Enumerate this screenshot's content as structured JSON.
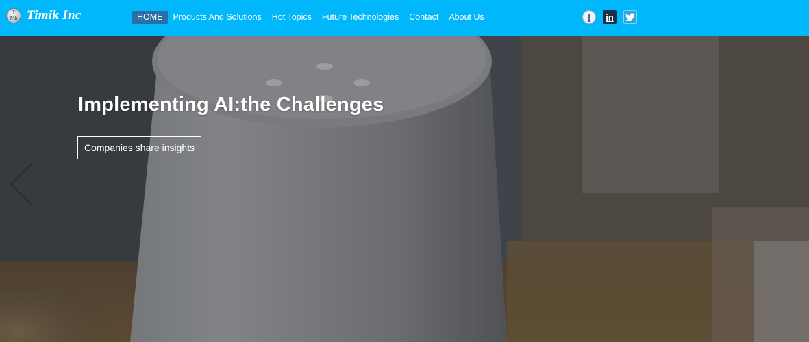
{
  "brand": {
    "name": "Timik Inc",
    "logo_badge_text": "T\nMk"
  },
  "nav": {
    "items": [
      {
        "label": "HOME",
        "active": true
      },
      {
        "label": "Products And Solutions",
        "active": false
      },
      {
        "label": "Hot Topics",
        "active": false
      },
      {
        "label": "Future Technologies",
        "active": false
      },
      {
        "label": "Contact",
        "active": false
      },
      {
        "label": "About Us",
        "active": false
      }
    ]
  },
  "social": {
    "icons": [
      "facebook-icon",
      "linkedin-icon",
      "twitter-icon"
    ],
    "facebook_glyph": "f",
    "linkedin_glyph": "in"
  },
  "hero": {
    "title": "Implementing AI:the Challenges",
    "cta_label": "Companies share insights",
    "prev_icon": "chevron-left-icon"
  },
  "colors": {
    "navbar_bg": "#00b7fb",
    "active_nav_bg": "#2a6fa3",
    "text": "#ffffff"
  }
}
